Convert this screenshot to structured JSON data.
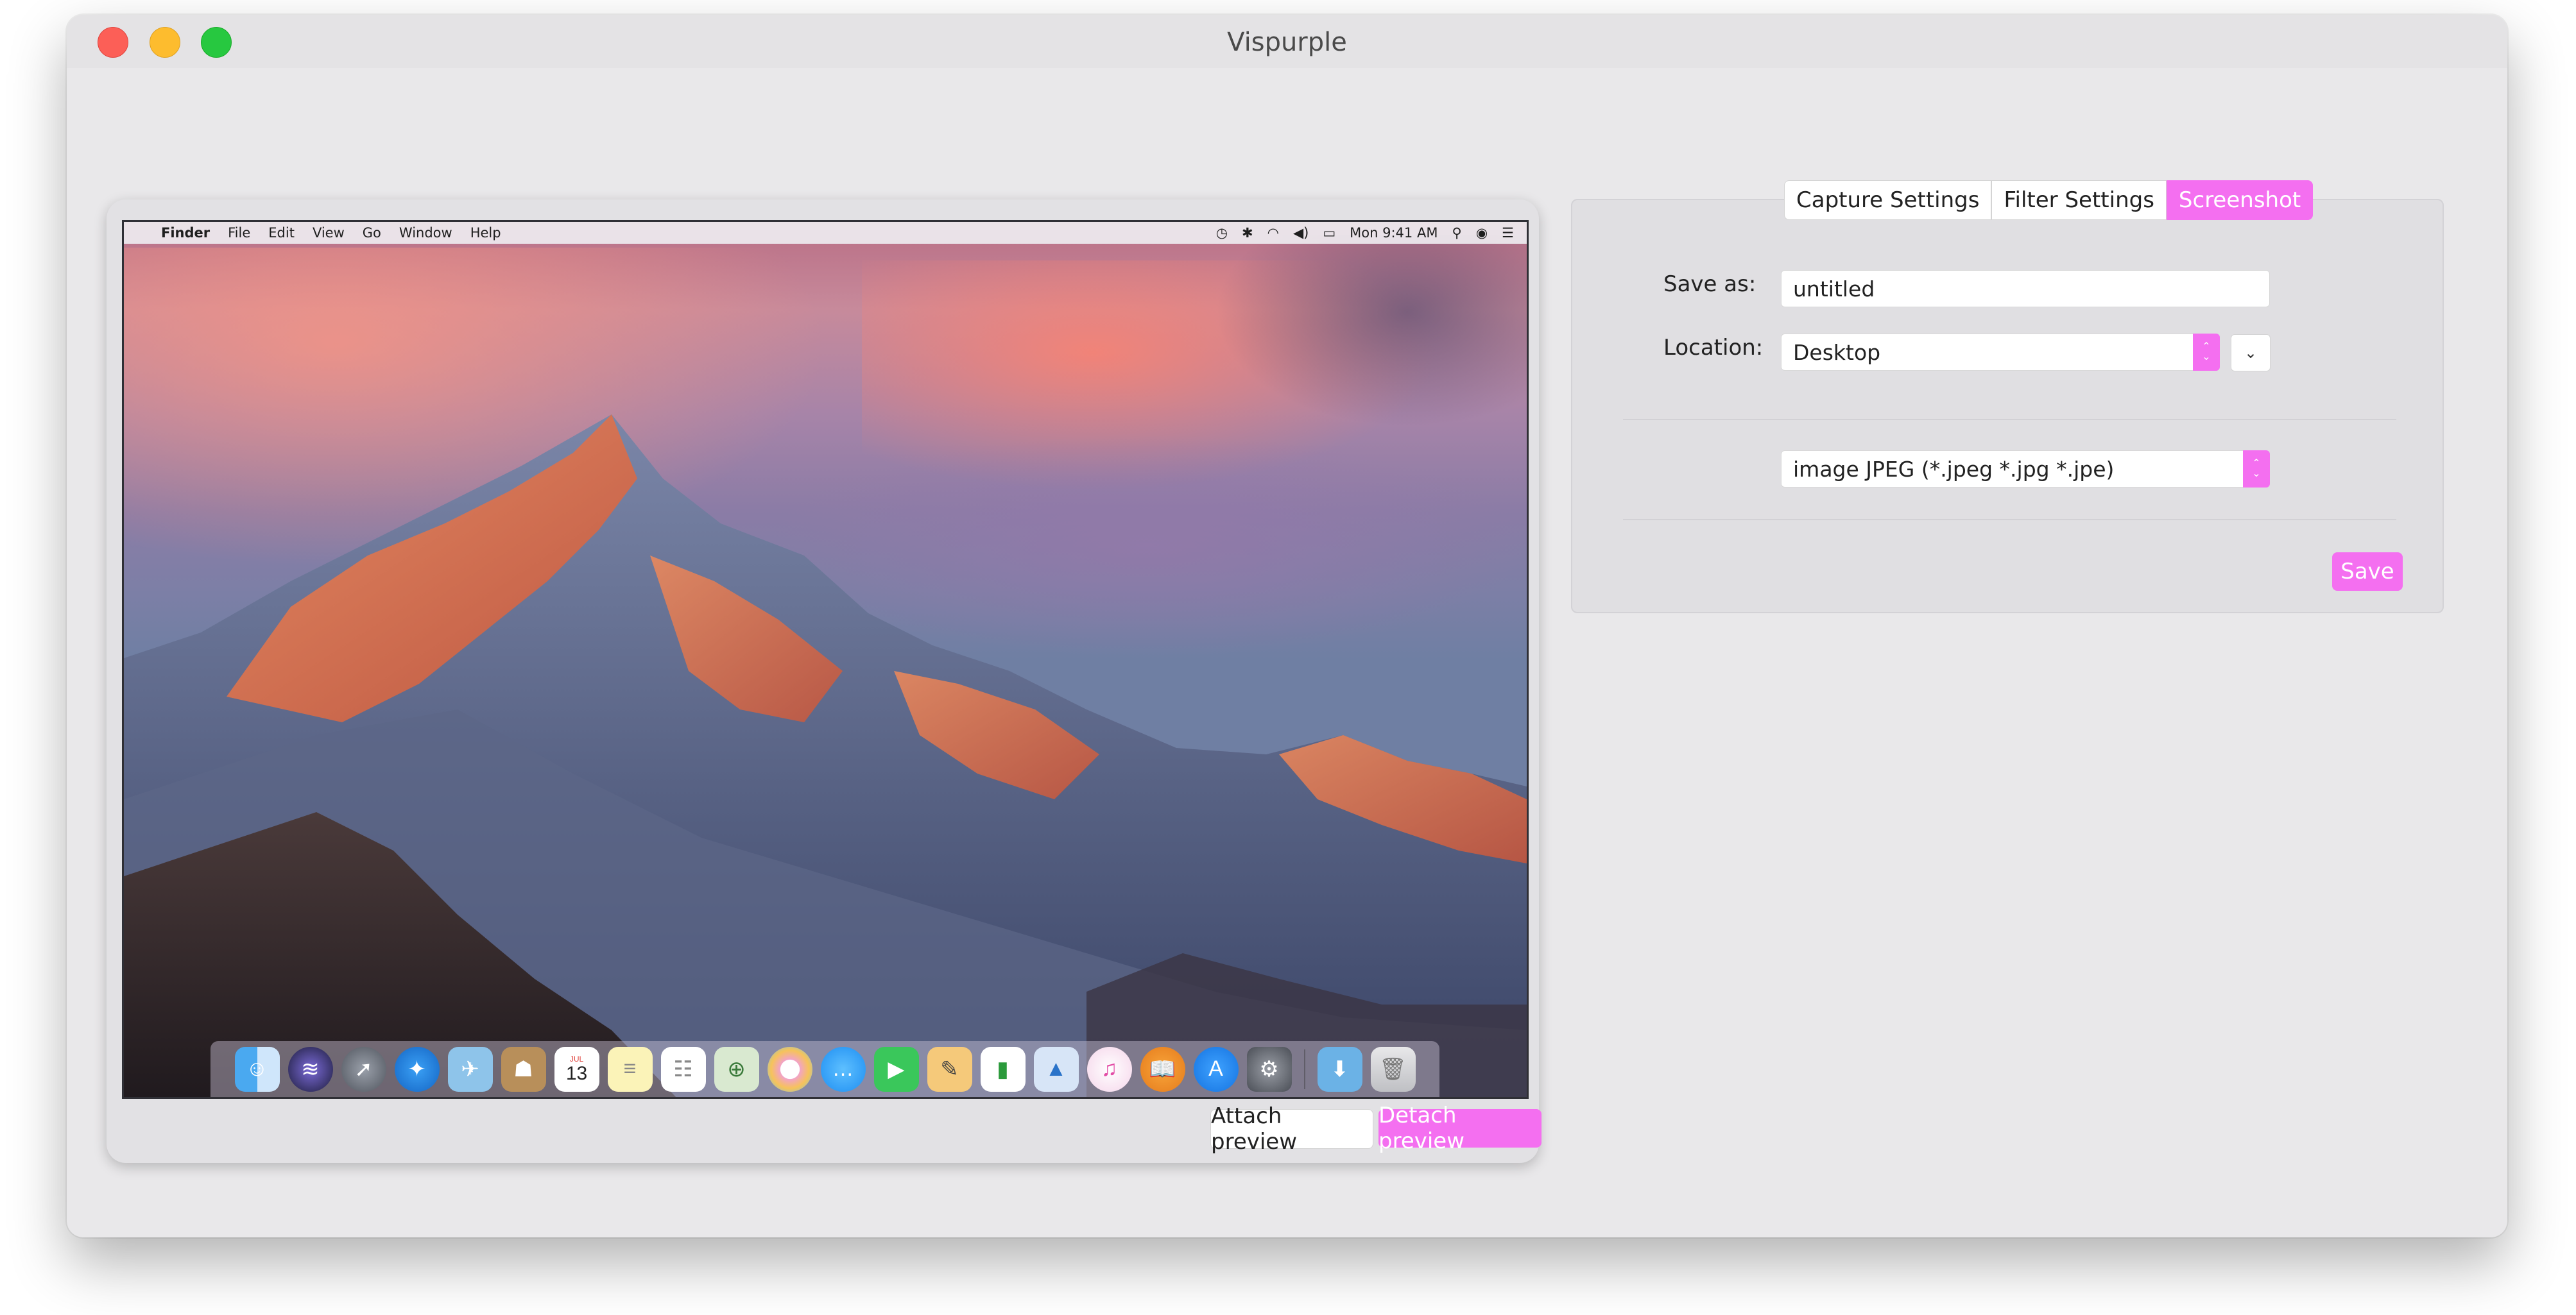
{
  "window": {
    "title": "Vispurple"
  },
  "preview": {
    "menubar": {
      "app_name": "Finder",
      "menus": [
        "File",
        "Edit",
        "View",
        "Go",
        "Window",
        "Help"
      ],
      "clock": "Mon 9:41 AM"
    },
    "dock": {
      "apps": [
        "finder-icon",
        "siri-icon",
        "launchpad-icon",
        "safari-icon",
        "mail-icon",
        "contacts-icon",
        "calendar-icon",
        "notes-icon",
        "reminders-icon",
        "maps-icon",
        "photos-icon",
        "messages-icon",
        "facetime-icon",
        "pages-icon",
        "numbers-icon",
        "keynote-icon",
        "itunes-icon",
        "ibooks-icon",
        "app-store-icon",
        "system-preferences-icon"
      ],
      "extras": [
        "downloads-folder-icon",
        "trash-icon"
      ],
      "calendar_month": "JUL",
      "calendar_day": "13"
    },
    "attach_label": "Attach preview",
    "detach_label": "Detach preview"
  },
  "settings": {
    "tabs": [
      {
        "label": "Capture Settings",
        "active": false
      },
      {
        "label": "Filter Settings",
        "active": false
      },
      {
        "label": "Screenshot",
        "active": true
      }
    ],
    "save_as_label": "Save as:",
    "save_as_value": "untitled",
    "location_label": "Location:",
    "location_value": "Desktop",
    "format_value": "image JPEG (*.jpeg *.jpg *.jpe)",
    "save_label": "Save"
  },
  "colors": {
    "accent": "#f46ff0",
    "window_bg": "#e9e8ea"
  }
}
